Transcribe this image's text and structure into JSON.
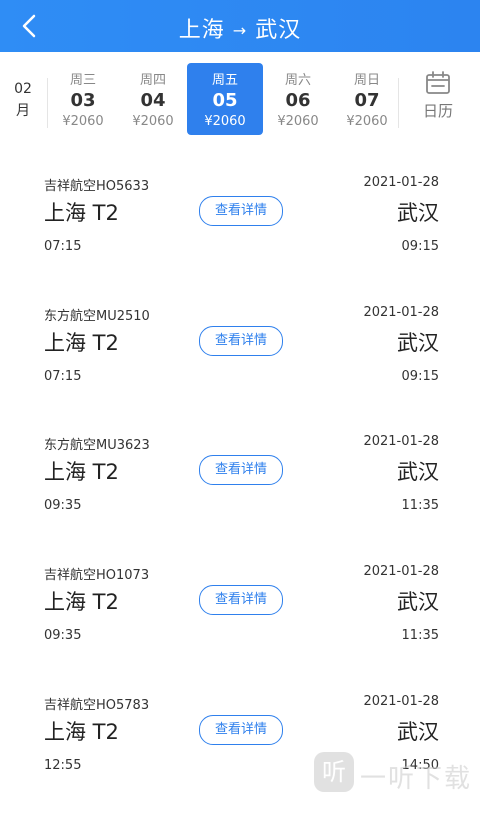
{
  "header": {
    "from": "上海",
    "arrow": "→",
    "to": "武汉",
    "back_icon": "chevron-left-icon"
  },
  "date_bar": {
    "month_num": "02",
    "month_unit": "月",
    "days": [
      {
        "weekday": "周三",
        "date": "03",
        "price": "¥2060",
        "active": false
      },
      {
        "weekday": "周四",
        "date": "04",
        "price": "¥2060",
        "active": false
      },
      {
        "weekday": "周五",
        "date": "05",
        "price": "¥2060",
        "active": true
      },
      {
        "weekday": "周六",
        "date": "06",
        "price": "¥2060",
        "active": false
      },
      {
        "weekday": "周日",
        "date": "07",
        "price": "¥2060",
        "active": false
      }
    ],
    "calendar_label": "日历",
    "calendar_icon": "calendar-icon"
  },
  "flights": [
    {
      "airline": "吉祥航空HO5633",
      "date": "2021-01-28",
      "from": "上海 T2",
      "to": "武汉",
      "dep": "07:15",
      "arr": "09:15",
      "button": "查看详情"
    },
    {
      "airline": "东方航空MU2510",
      "date": "2021-01-28",
      "from": "上海 T2",
      "to": "武汉",
      "dep": "07:15",
      "arr": "09:15",
      "button": "查看详情"
    },
    {
      "airline": "东方航空MU3623",
      "date": "2021-01-28",
      "from": "上海 T2",
      "to": "武汉",
      "dep": "09:35",
      "arr": "11:35",
      "button": "查看详情"
    },
    {
      "airline": "吉祥航空HO1073",
      "date": "2021-01-28",
      "from": "上海 T2",
      "to": "武汉",
      "dep": "09:35",
      "arr": "11:35",
      "button": "查看详情"
    },
    {
      "airline": "吉祥航空HO5783",
      "date": "2021-01-28",
      "from": "上海 T2",
      "to": "武汉",
      "dep": "12:55",
      "arr": "14:50",
      "button": "查看详情"
    }
  ],
  "watermark": {
    "logo_char": "听",
    "text": "一听下载"
  },
  "colors": {
    "primary": "#2f80ed",
    "header": "#2f8df5"
  }
}
